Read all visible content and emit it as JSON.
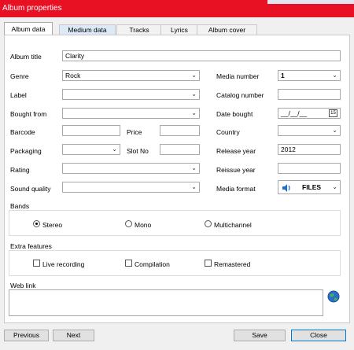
{
  "window": {
    "title": "Album properties"
  },
  "tabs": [
    {
      "label": "Album data"
    },
    {
      "label": "Medium data"
    },
    {
      "label": "Tracks"
    },
    {
      "label": "Lyrics"
    },
    {
      "label": "Album cover"
    }
  ],
  "fields": {
    "album_title": {
      "label": "Album title",
      "value": "Clarity"
    },
    "genre": {
      "label": "Genre",
      "value": "Rock"
    },
    "label": {
      "label": "Label",
      "value": ""
    },
    "bought_from": {
      "label": "Bought from",
      "value": ""
    },
    "barcode": {
      "label": "Barcode",
      "value": ""
    },
    "price": {
      "label": "Price",
      "value": ""
    },
    "packaging": {
      "label": "Packaging",
      "value": ""
    },
    "slot_no": {
      "label": "Slot No",
      "value": ""
    },
    "rating": {
      "label": "Rating",
      "value": ""
    },
    "sound_quality": {
      "label": "Sound quality",
      "value": ""
    },
    "media_number": {
      "label": "Media number",
      "value": "1"
    },
    "catalog_number": {
      "label": "Catalog number",
      "value": ""
    },
    "date_bought": {
      "label": "Date bought",
      "value": "__/__/__"
    },
    "country": {
      "label": "Country",
      "value": ""
    },
    "release_year": {
      "label": "Release year",
      "value": "2012"
    },
    "reissue_year": {
      "label": "Reissue year",
      "value": ""
    },
    "media_format": {
      "label": "Media format",
      "value": "FILES"
    }
  },
  "bands": {
    "label": "Bands",
    "options": [
      {
        "label": "Stereo",
        "selected": true
      },
      {
        "label": "Mono",
        "selected": false
      },
      {
        "label": "Multichannel",
        "selected": false
      }
    ]
  },
  "extra_features": {
    "label": "Extra features",
    "options": [
      {
        "label": "Live recording",
        "checked": false
      },
      {
        "label": "Compilation",
        "checked": false
      },
      {
        "label": "Remastered",
        "checked": false
      }
    ]
  },
  "web_link": {
    "label": "Web link",
    "value": ""
  },
  "buttons": {
    "previous": "Previous",
    "next": "Next",
    "save": "Save",
    "close": "Close"
  },
  "colors": {
    "titlebar": "#e81123",
    "tab_highlight": "#dde9f7",
    "default_button_border": "#0078d7"
  },
  "icons": {
    "calendar": "calendar-icon",
    "speaker": "speaker-icon",
    "globe": "globe-icon"
  }
}
